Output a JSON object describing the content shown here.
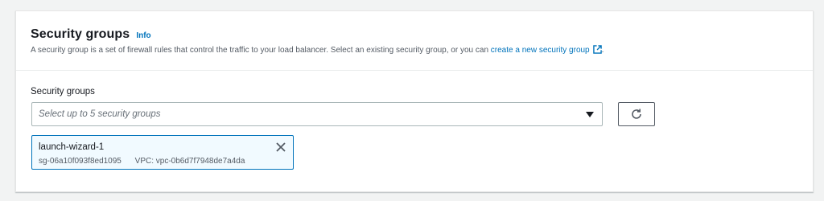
{
  "section": {
    "title": "Security groups",
    "info_label": "Info",
    "description_prefix": "A security group is a set of firewall rules that control the traffic to your load balancer. Select an existing security group, or you can",
    "description_link": "create a new security group",
    "description_suffix": "."
  },
  "field": {
    "label": "Security groups",
    "placeholder": "Select up to 5 security groups"
  },
  "selected_groups": [
    {
      "name": "launch-wizard-1",
      "id": "sg-06a10f093f8ed1095",
      "vpc": "VPC: vpc-0b6d7f7948de7a4da"
    }
  ],
  "icons": {
    "external": "external-link-icon",
    "caret": "caret-down-icon",
    "refresh": "refresh-icon",
    "remove": "close-icon"
  },
  "colors": {
    "link": "#0073bb",
    "token_bg": "#f1faff",
    "token_border": "#0073bb"
  }
}
